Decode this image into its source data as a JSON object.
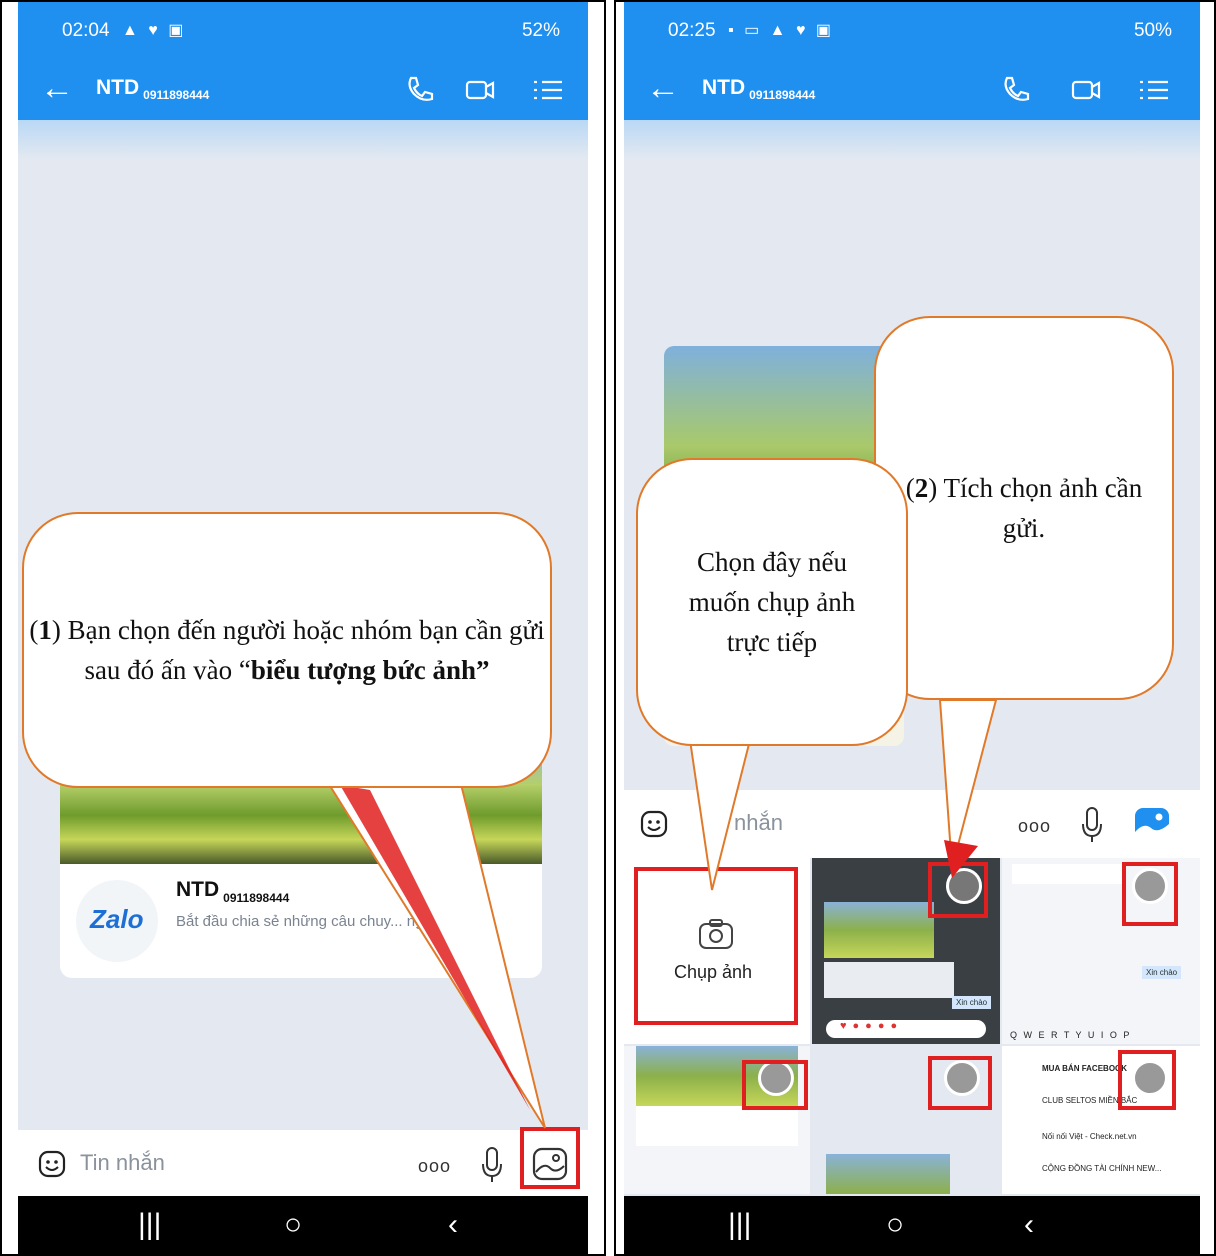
{
  "left_phone": {
    "status_time": "02:04",
    "status_battery": "52%",
    "header": {
      "name": "NTD",
      "phone": "0911898444"
    },
    "card": {
      "logo_text": "Zalo",
      "name": "NTD",
      "phone": "0911898444",
      "description": "Bắt đầu chia sẻ những câu chuy... ng nhau"
    },
    "input_placeholder": "Tin nhắn",
    "more_label": "ooo"
  },
  "right_phone": {
    "status_time": "02:25",
    "status_battery": "50%",
    "header": {
      "name": "NTD",
      "phone": "0911898444"
    },
    "input_placeholder": "nhắn",
    "more_label": "ooo",
    "camera_tile_label": "Chụp ảnh",
    "mini_screens": {
      "chat_hello": "Xin chào",
      "keyboard_row": "Q W E R T Y U I O P",
      "list": [
        "MUA BÁN FACEBOOK",
        "CLUB SELTOS MIỀN BẮC",
        "Nối nối Việt - Check.net.vn",
        "CỘNG ĐỒNG TÀI CHÍNH NEW..."
      ]
    }
  },
  "callouts": {
    "step1_num": "1",
    "step1_text": ") Bạn chọn đến người hoặc nhóm bạn cần gửi sau đó ấn vào “",
    "step1_bold": "biểu tượng bức ảnh”",
    "step2_num": "2",
    "step2_text": ") Tích chọn ảnh cần gửi.",
    "camera_hint": "Chọn đây nếu muốn chụp ảnh trực tiếp"
  },
  "colors": {
    "zalo_blue": "#1f8ff0",
    "callout_border": "#e07a2a",
    "highlight_red": "#e02020"
  }
}
